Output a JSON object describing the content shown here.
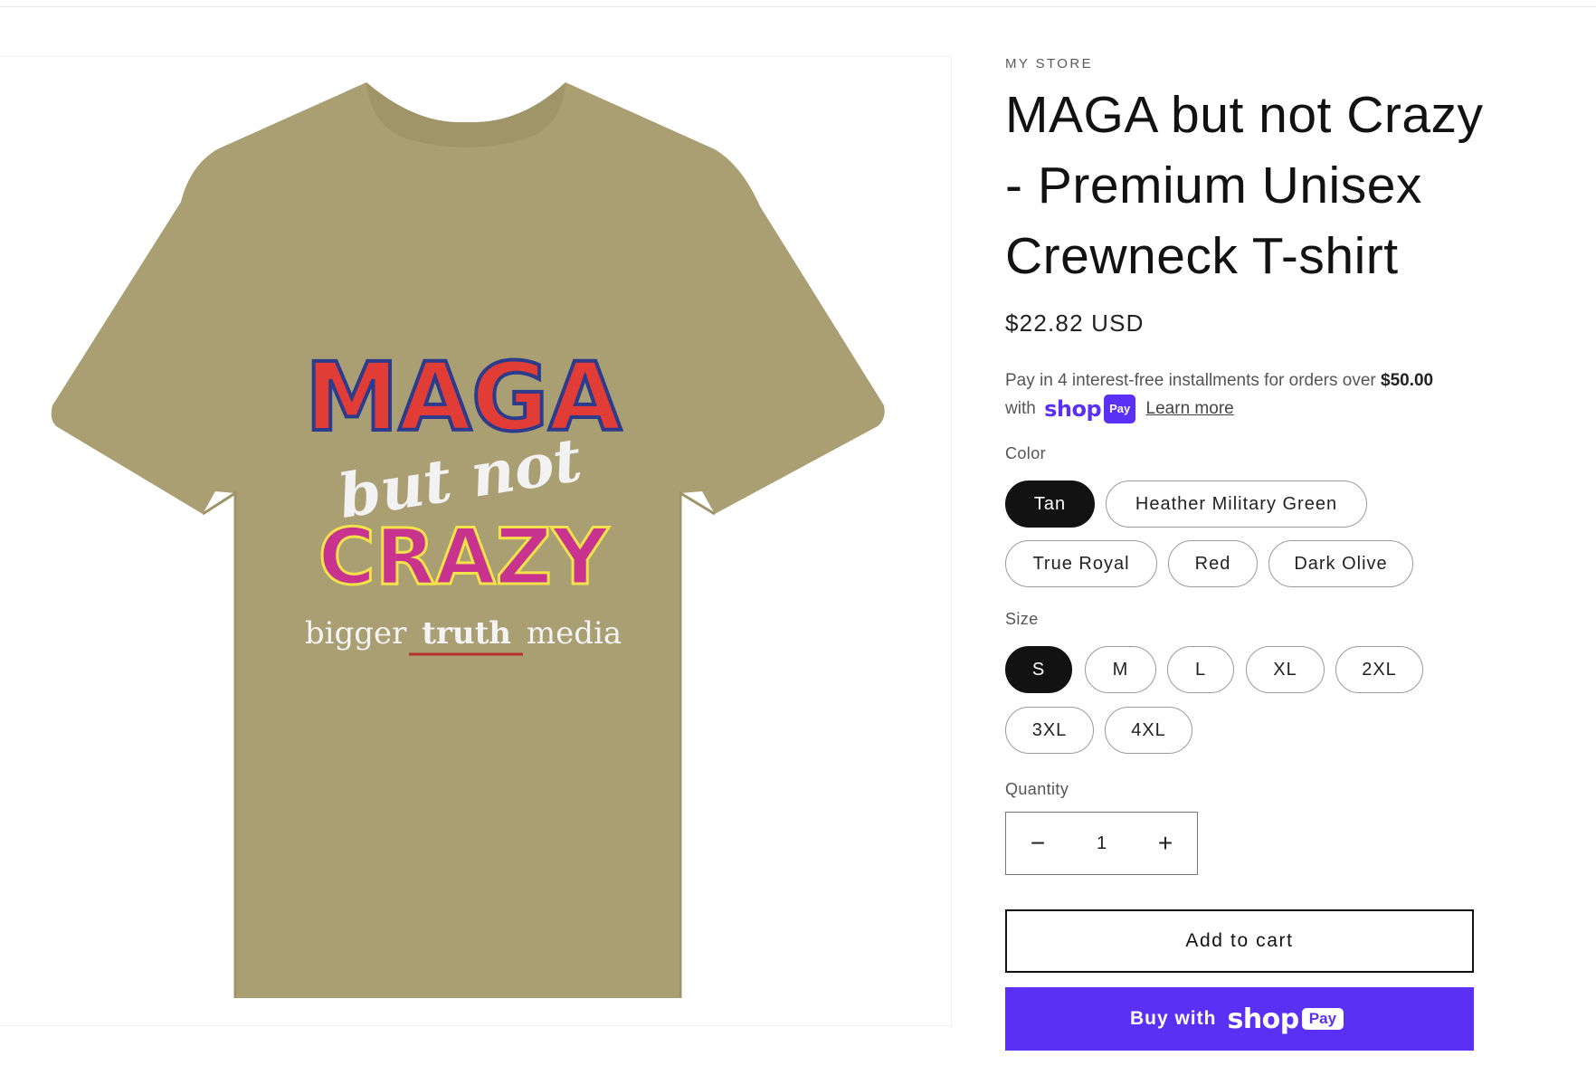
{
  "product": {
    "vendor": "MY STORE",
    "title": "MAGA but not Crazy - Premium Unisex Crewneck T-shirt",
    "price": "$22.82 USD",
    "image_alt": "Tan t-shirt with MAGA but not Crazy print"
  },
  "installments": {
    "text_before": "Pay in 4 interest-free installments for orders over ",
    "amount": "$50.00",
    "with": "with",
    "shop_word": "shop",
    "pay_chip": "Pay",
    "learn_more": "Learn more"
  },
  "color": {
    "label": "Color",
    "options": [
      "Tan",
      "Heather Military Green",
      "True Royal",
      "Red",
      "Dark Olive"
    ],
    "selected": "Tan"
  },
  "size": {
    "label": "Size",
    "options": [
      "S",
      "M",
      "L",
      "XL",
      "2XL",
      "3XL",
      "4XL"
    ],
    "selected": "S"
  },
  "quantity": {
    "label": "Quantity",
    "value": "1",
    "minus": "−",
    "plus": "+"
  },
  "actions": {
    "add_to_cart": "Add to cart",
    "buy_with": "Buy with",
    "shop_word": "shop",
    "pay_chip": "Pay"
  },
  "shirt_print": {
    "line1": "MAGA",
    "line2": "but not",
    "line3": "CRAZY",
    "line4a": "bigger",
    "line4b": "truth",
    "line4c": "media"
  },
  "colors": {
    "shirt": "#aa9f73",
    "shop_pay": "#5a31f4",
    "selected_pill": "#121212"
  }
}
